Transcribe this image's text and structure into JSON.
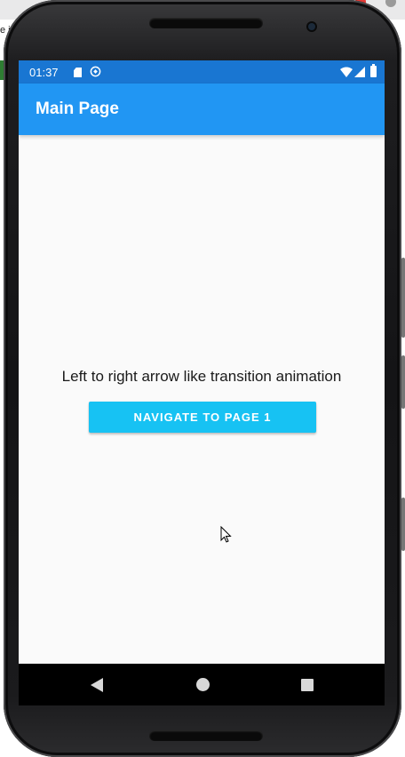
{
  "status_bar": {
    "time": "01:37",
    "color": "#1976d2",
    "icons": [
      "sd-card-icon",
      "sync-icon",
      "wifi-icon",
      "cell-signal-icon",
      "battery-icon"
    ]
  },
  "app_bar": {
    "title": "Main Page",
    "color": "#2196f3"
  },
  "main": {
    "description": "Left to right arrow like transition animation",
    "button_label": "NAVIGATE TO PAGE 1",
    "button_color": "#17c2f3"
  },
  "android_nav": {
    "icons": [
      "back-icon",
      "home-icon",
      "recents-icon"
    ]
  },
  "background": {
    "side_text": "e j"
  }
}
